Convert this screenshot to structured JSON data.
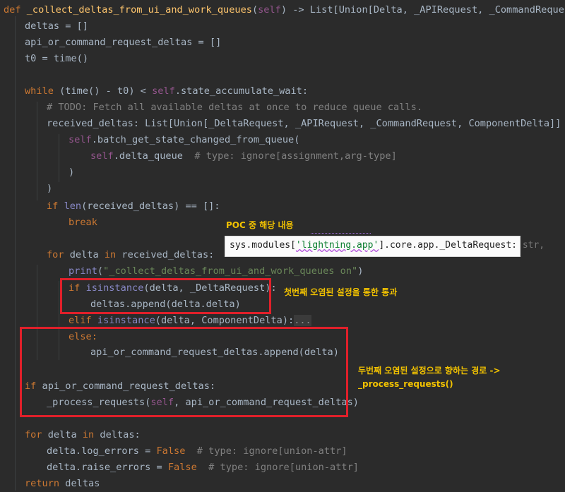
{
  "code": {
    "l1": {
      "def": "def ",
      "fn": "_collect_deltas_from_ui_and_work_queues",
      "open": "(",
      "self": "self",
      "rest": ") -> List[Union[Delta, _APIRequest, _CommandRequest]]:"
    },
    "l2": "deltas = []",
    "l3": "api_or_command_request_deltas = []",
    "l4": "t0 = time()",
    "l5": {
      "kw": "while",
      "a": " (time() - t0) < ",
      "self": "self",
      "b": ".state_accumulate_wait:"
    },
    "l6": "# TODO: Fetch all available deltas at once to reduce queue calls.",
    "l7": "received_deltas: List[Union[_DeltaRequest, _APIRequest, _CommandRequest, ComponentDelta]] = (",
    "l8": {
      "self": "self",
      "rest": ".batch_get_state_changed_from_queue("
    },
    "l9": {
      "self": "self",
      "rest": ".delta_queue  ",
      "cmt": "# type: ignore[assignment,arg-type]"
    },
    "l10": ")",
    "l11": ")",
    "l12": {
      "kw": "if ",
      "bi": "len",
      "rest": "(received_deltas) == []:"
    },
    "l13": "break",
    "l14": {
      "kw": "for",
      "a": " delta ",
      "kw2": "in",
      "b": " received_deltas:"
    },
    "l15": {
      "bi": "print",
      "open": "(",
      "str": "\"_collect_deltas_from_ui_and_work_queues on\"",
      "close": ")"
    },
    "l16": {
      "kw": "if ",
      "bi": "isinstance",
      "rest": "(delta, _DeltaRequest):"
    },
    "l17": "deltas.append(delta.delta)",
    "l18": {
      "kw": "elif ",
      "bi": "isinstance",
      "rest": "(delta, ComponentDelta):",
      "fold": "..."
    },
    "l19": "else:",
    "l20": "api_or_command_request_deltas.append(delta)",
    "l21": {
      "kw": "if",
      "rest": " api_or_command_request_deltas:"
    },
    "l22": {
      "a": "_process_requests(",
      "self": "self",
      "b": ", api_or_command_request_deltas)"
    },
    "l23": {
      "kw": "for",
      "a": " delta ",
      "kw2": "in",
      "b": " deltas:"
    },
    "l24": {
      "a": "delta.log_errors = ",
      "kw": "False",
      "cmt": "  # type: ignore[union-attr]"
    },
    "l25": {
      "a": "delta.raise_errors = ",
      "kw": "False",
      "cmt": "  # type: ignore[union-attr]"
    },
    "l26": {
      "kw": "return",
      "rest": " deltas"
    }
  },
  "annotations": {
    "poc_title": "POC 중 해당 내용",
    "poc_code_a": "sys.modules[",
    "poc_code_str": "'lightning.app'",
    "poc_code_b": "].core.app._DeltaRequest: ",
    "poc_code_type": "str,",
    "first_note": "첫번째 오염된 설정을 통한 통과",
    "second_note_line1": "두번째 오염된 설정으로 향하는 경로 ->",
    "second_note_line2": "_process_requests()"
  },
  "colors": {
    "background": "#2b2b2b",
    "keyword": "#cc7832",
    "function": "#ffc66d",
    "self": "#94558d",
    "string": "#6a8759",
    "comment": "#808080",
    "highlight_box": "#e0202a",
    "note_text": "#f2c200"
  }
}
